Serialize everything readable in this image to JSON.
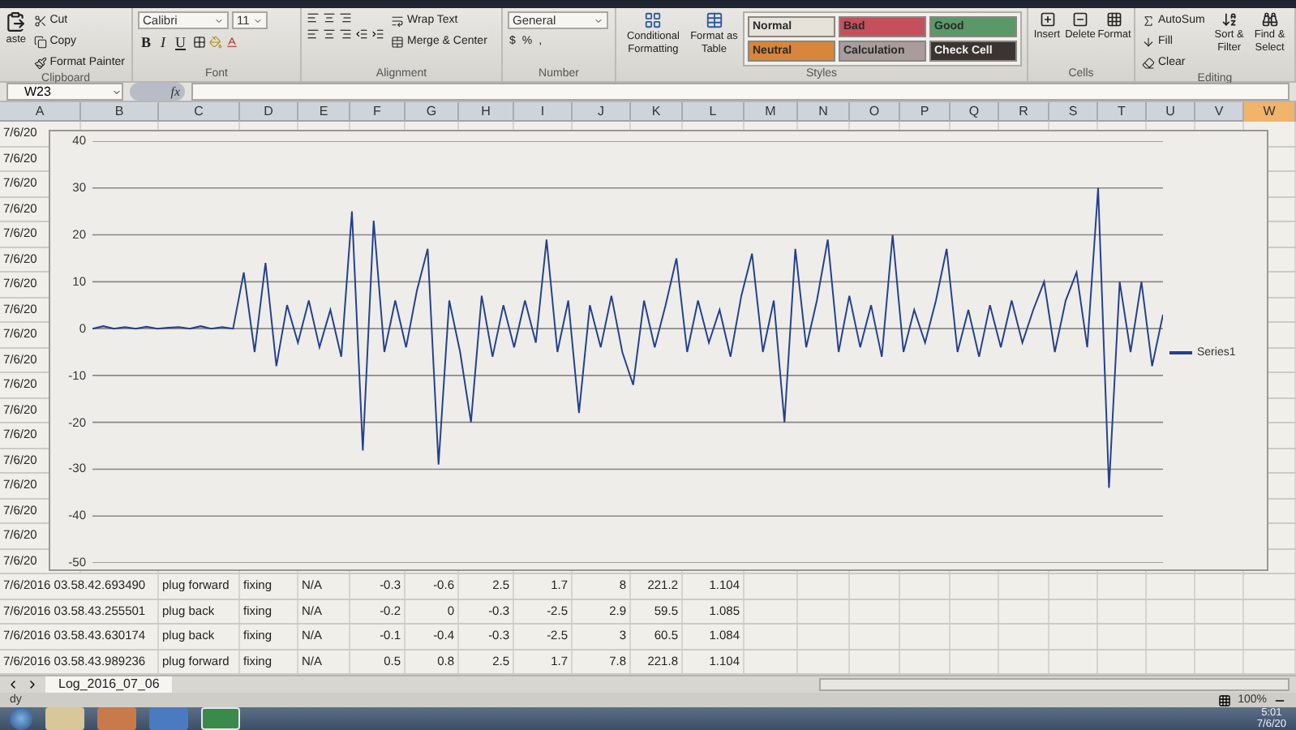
{
  "ribbon": {
    "clipboard": {
      "paste": "aste",
      "cut": "Cut",
      "copy": "Copy",
      "format_painter": "Format Painter",
      "label": "Clipboard"
    },
    "font": {
      "name": "Calibri",
      "size": "11",
      "bold": "B",
      "italic": "I",
      "underline": "U",
      "label": "Font"
    },
    "alignment": {
      "wrap_text": "Wrap Text",
      "merge_center": "Merge & Center",
      "label": "Alignment"
    },
    "number": {
      "format": "General",
      "currency": "$",
      "percent": "%",
      "comma": ",",
      "label": "Number"
    },
    "styles": {
      "conditional_formatting": "Conditional Formatting",
      "format_as_table": "Format as Table",
      "label": "Styles",
      "cell_styles": [
        {
          "label": "Normal",
          "color": "#e6e2da"
        },
        {
          "label": "Bad",
          "color": "#c4505c"
        },
        {
          "label": "Good",
          "color": "#5a9868"
        },
        {
          "label": "Neutral",
          "color": "#d8863a"
        },
        {
          "label": "Calculation",
          "color": "#a89c9c"
        },
        {
          "label": "Check Cell",
          "color": "#3a3432"
        }
      ]
    },
    "cells": {
      "buttons": [
        "Insert",
        "Delete",
        "Format"
      ],
      "label": "Cells"
    },
    "editing": {
      "autosum": "AutoSum",
      "fill": "Fill",
      "clear": "Clear",
      "sort_filter": "Sort & Filter",
      "find_select": "Find & Select",
      "label": "Editing"
    }
  },
  "formula_bar": {
    "name_box": "W23",
    "fx": "fx"
  },
  "columns": [
    {
      "label": "A",
      "selected": false
    },
    {
      "label": "B",
      "selected": false
    },
    {
      "label": "C",
      "selected": false
    },
    {
      "label": "D",
      "selected": false
    },
    {
      "label": "E",
      "selected": false
    },
    {
      "label": "F",
      "selected": false
    },
    {
      "label": "G",
      "selected": false
    },
    {
      "label": "H",
      "selected": false
    },
    {
      "label": "I",
      "selected": false
    },
    {
      "label": "J",
      "selected": false
    },
    {
      "label": "K",
      "selected": false
    },
    {
      "label": "L",
      "selected": false
    },
    {
      "label": "M",
      "selected": false
    },
    {
      "label": "N",
      "selected": false
    },
    {
      "label": "O",
      "selected": false
    },
    {
      "label": "P",
      "selected": false
    },
    {
      "label": "Q",
      "selected": false
    },
    {
      "label": "R",
      "selected": false
    },
    {
      "label": "S",
      "selected": false
    },
    {
      "label": "T",
      "selected": false
    },
    {
      "label": "U",
      "selected": false
    },
    {
      "label": "V",
      "selected": false
    },
    {
      "label": "W",
      "selected": true
    }
  ],
  "covered_rows": [
    "7/6/20",
    "7/6/20",
    "7/6/20",
    "7/6/20",
    "7/6/20",
    "7/6/20",
    "7/6/20",
    "7/6/20",
    "7/6/20",
    "7/6/20",
    "7/6/20",
    "7/6/20",
    "7/6/20",
    "7/6/20",
    "7/6/20",
    "7/6/20",
    "7/6/20",
    "7/6/20"
  ],
  "chart": {
    "chart_data": {
      "type": "line",
      "grid": true,
      "ylim": [
        -50,
        40
      ],
      "yticks": [
        40,
        30,
        20,
        10,
        0,
        -10,
        -20,
        -30,
        -40,
        -50
      ],
      "series": [
        {
          "name": "Series1",
          "color": "#23408e",
          "values": [
            0,
            0.5,
            0,
            0.3,
            0,
            0.4,
            0,
            0.2,
            0.3,
            0,
            0.5,
            0,
            0.3,
            0,
            12,
            -5,
            14,
            -8,
            5,
            -3,
            6,
            -4,
            4,
            -6,
            25,
            -26,
            23,
            -5,
            6,
            -4,
            8,
            17,
            -29,
            6,
            -5,
            -20,
            7,
            -6,
            5,
            -4,
            6,
            -3,
            19,
            -5,
            6,
            -18,
            5,
            -4,
            7,
            -5,
            -12,
            6,
            -4,
            5,
            15,
            -5,
            6,
            -3,
            4,
            -6,
            7,
            16,
            -5,
            6,
            -20,
            17,
            -4,
            6,
            19,
            -5,
            7,
            -4,
            5,
            -6,
            20,
            -5,
            4,
            -3,
            6,
            17,
            -5,
            4,
            -6,
            5,
            -4,
            6,
            -3,
            4,
            10,
            -5,
            6,
            12,
            -4,
            30,
            -34,
            10,
            -5,
            10,
            -8,
            3
          ]
        }
      ]
    }
  },
  "data_rows": [
    {
      "cells": [
        "7/6/2016 03.58.42.693490",
        "plug forward",
        "fixing",
        "N/A",
        "-0.3",
        "-0.6",
        "2.5",
        "1.7",
        "8",
        "221.2",
        "1.104"
      ]
    },
    {
      "cells": [
        "7/6/2016 03.58.43.255501",
        "plug back",
        "fixing",
        "N/A",
        "-0.2",
        "0",
        "-0.3",
        "-2.5",
        "2.9",
        "59.5",
        "1.085"
      ]
    },
    {
      "cells": [
        "7/6/2016 03.58.43.630174",
        "plug back",
        "fixing",
        "N/A",
        "-0.1",
        "-0.4",
        "-0.3",
        "-2.5",
        "3",
        "60.5",
        "1.084"
      ]
    },
    {
      "cells": [
        "7/6/2016 03.58.43.989236",
        "plug forward",
        "fixing",
        "N/A",
        "0.5",
        "0.8",
        "2.5",
        "1.7",
        "7.8",
        "221.8",
        "1.104"
      ]
    }
  ],
  "sheet_tabs": [
    {
      "label": "Log_2016_07_06",
      "selected": true
    }
  ],
  "status_bar": {
    "status": "dy",
    "zoom": "100%"
  },
  "taskbar": {
    "clock_time": "5:01",
    "clock_date": "7/6/20"
  }
}
